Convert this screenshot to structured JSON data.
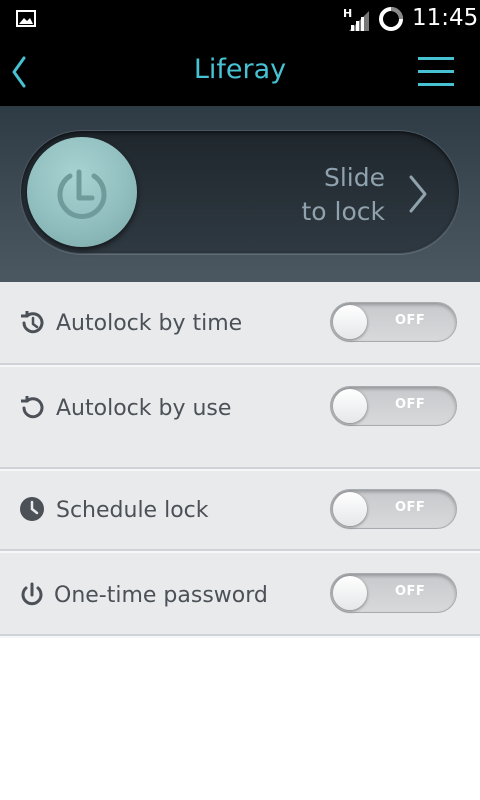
{
  "status_bar": {
    "time": "11:45",
    "network_type": "H",
    "icons": [
      "gallery-icon",
      "signal-icon",
      "sync-icon"
    ]
  },
  "app_bar": {
    "title": "Liferay",
    "back_icon": "chevron-left-icon",
    "menu_icon": "hamburger-menu-icon",
    "accent_color": "#47c2d3"
  },
  "slide_lock": {
    "line1": "Slide",
    "line2": "to lock",
    "knob_icon": "lock-power-icon",
    "arrow_icon": "chevron-right-icon"
  },
  "settings": [
    {
      "label": "Autolock by time",
      "icon": "history-clock-icon",
      "toggle": "OFF"
    },
    {
      "label": "Autolock by use",
      "icon": "reset-icon",
      "toggle": "OFF"
    },
    {
      "label": "Schedule lock",
      "icon": "clock-icon",
      "toggle": "OFF"
    },
    {
      "label": "One-time password",
      "icon": "power-icon",
      "toggle": "OFF"
    }
  ]
}
